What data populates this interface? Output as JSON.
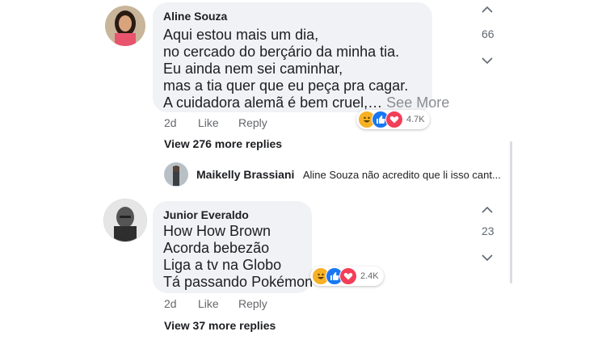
{
  "comments": [
    {
      "author": "Aline Souza",
      "lines": [
        "Aqui estou mais um dia,",
        "no cercado do berçário da minha tia.",
        "Eu ainda nem sei caminhar,",
        "mas a tia quer que eu peça pra cagar.",
        "A cuidadora alemã é bem cruel,…"
      ],
      "see_more": "See More",
      "time": "2d",
      "like_label": "Like",
      "reply_label": "Reply",
      "reactions_count": "4.7K",
      "side_count": "66",
      "view_replies": "View 276 more replies"
    },
    {
      "author": "Junior Everaldo",
      "lines": [
        "How How Brown",
        "Acorda bebezão",
        "Liga a tv na Globo",
        "Tá passando Pokémon"
      ],
      "time": "2d",
      "like_label": "Like",
      "reply_label": "Reply",
      "reactions_count": "2.4K",
      "side_count": "23",
      "view_replies": "View 37 more replies"
    }
  ],
  "reply_preview": {
    "author": "Maikelly Brassiani",
    "text": "Aline Souza não acredito que li isso cant..."
  },
  "colors": {
    "bubble": "#f0f2f5",
    "haha": "#f7b125",
    "like": "#1877f2",
    "love": "#f33e58"
  },
  "icons": [
    "haha-icon",
    "like-icon",
    "love-icon",
    "chevron-up-icon",
    "chevron-down-icon"
  ]
}
